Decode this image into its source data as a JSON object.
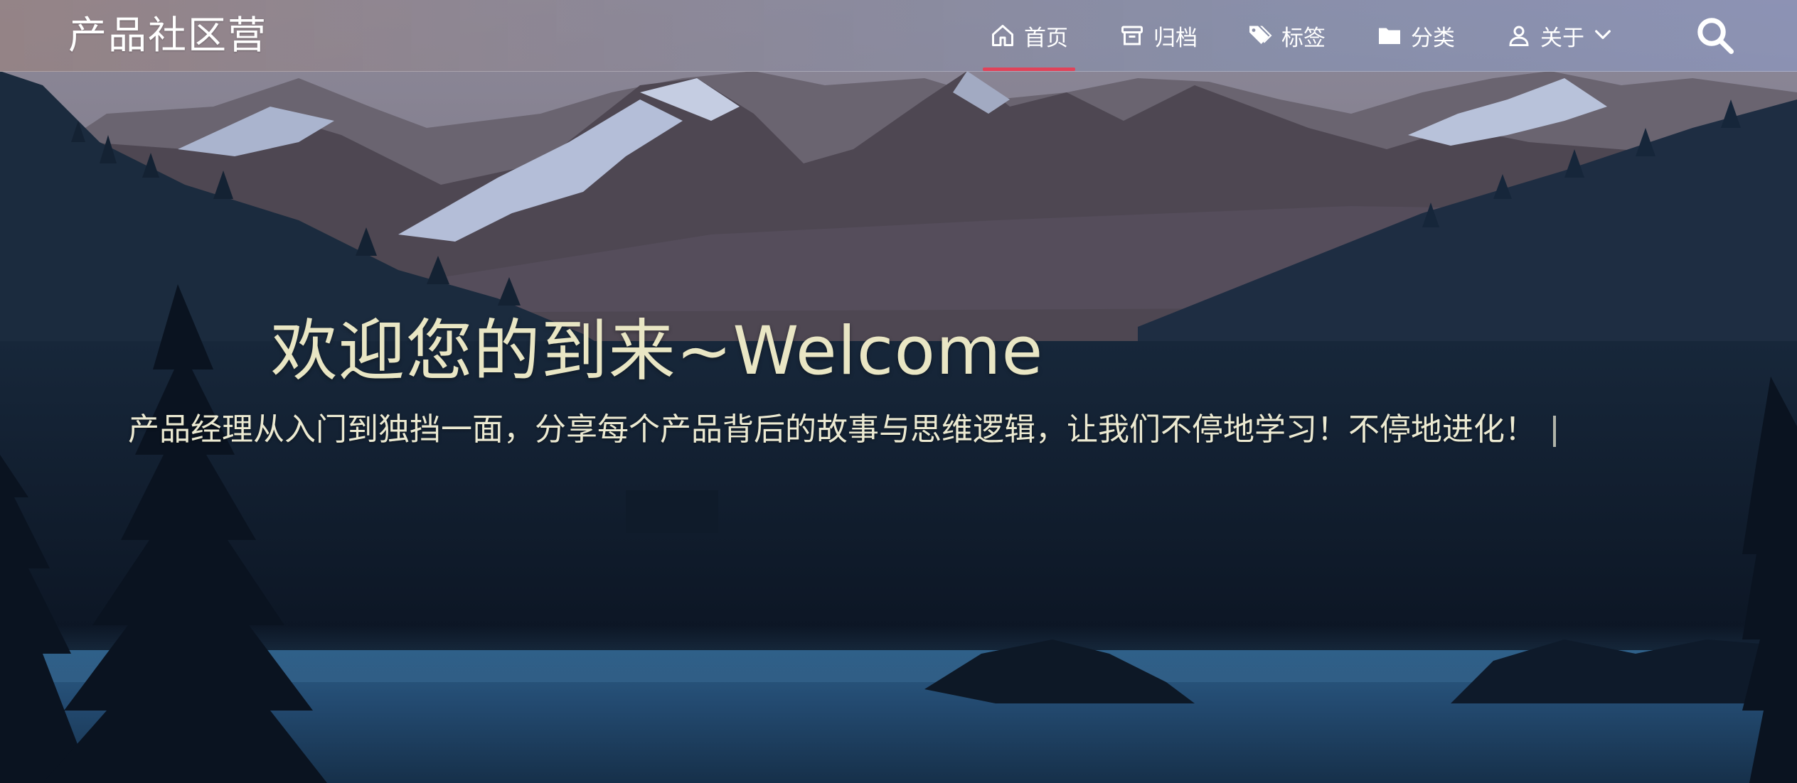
{
  "site": {
    "brand": "产品社区营"
  },
  "nav": {
    "items": [
      {
        "label": "首页",
        "icon": "home-icon",
        "active": true
      },
      {
        "label": "归档",
        "icon": "archive-icon",
        "active": false
      },
      {
        "label": "标签",
        "icon": "tags-icon",
        "active": false
      },
      {
        "label": "分类",
        "icon": "folder-icon",
        "active": false
      },
      {
        "label": "关于",
        "icon": "user-icon",
        "active": false,
        "dropdown": true
      }
    ],
    "search_icon": "search-icon",
    "active_color": "#e0435a"
  },
  "hero": {
    "title": "欢迎您的到来~Welcome",
    "subtitle": "产品经理从入门到独挡一面，分享每个产品背后的故事与思维逻辑，让我们不停地学习！不停地进化！",
    "title_color": "#e9e6c4"
  }
}
